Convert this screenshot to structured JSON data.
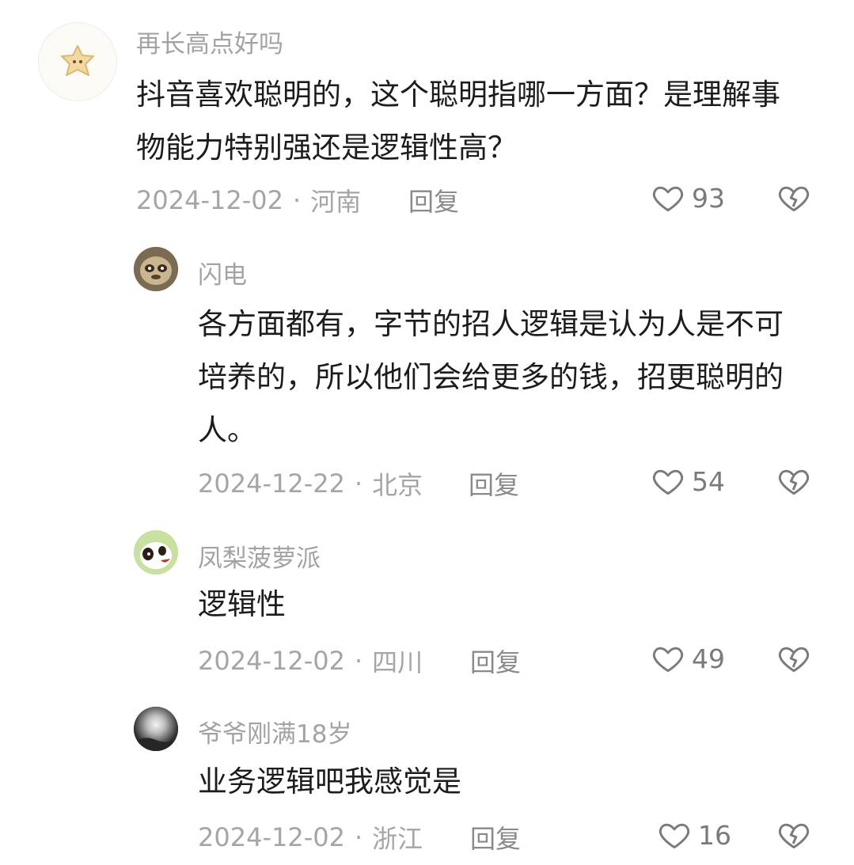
{
  "comments": [
    {
      "username": "再长高点好吗",
      "text": "抖音喜欢聪明的，这个聪明指哪一方面？是理解事物能力特别强还是逻辑性高？",
      "date": "2024-12-02",
      "location": "河南",
      "reply_label": "回复",
      "likes": "93",
      "avatar_icon": "star-cookie-avatar"
    },
    {
      "username": "闪电",
      "text": "各方面都有，字节的招人逻辑是认为人是不可培养的，所以他们会给更多的钱，招更聪明的人。",
      "date": "2024-12-22",
      "location": "北京",
      "reply_label": "回复",
      "likes": "54",
      "avatar_icon": "sloth-avatar"
    },
    {
      "username": "凤梨菠萝派",
      "text": "逻辑性",
      "date": "2024-12-02",
      "location": "四川",
      "reply_label": "回复",
      "likes": "49",
      "avatar_icon": "cartoon-dog-avatar"
    },
    {
      "username": "爷爷刚满18岁",
      "text": "业务逻辑吧我感觉是",
      "date": "2024-12-02",
      "location": "浙江",
      "reply_label": "回复",
      "likes": "16",
      "avatar_icon": "moon-photo-avatar"
    }
  ],
  "meta_separator": "·",
  "colors": {
    "text": "#1c1c1c",
    "muted": "#a5a5a5",
    "icon": "#7a7a7a"
  }
}
